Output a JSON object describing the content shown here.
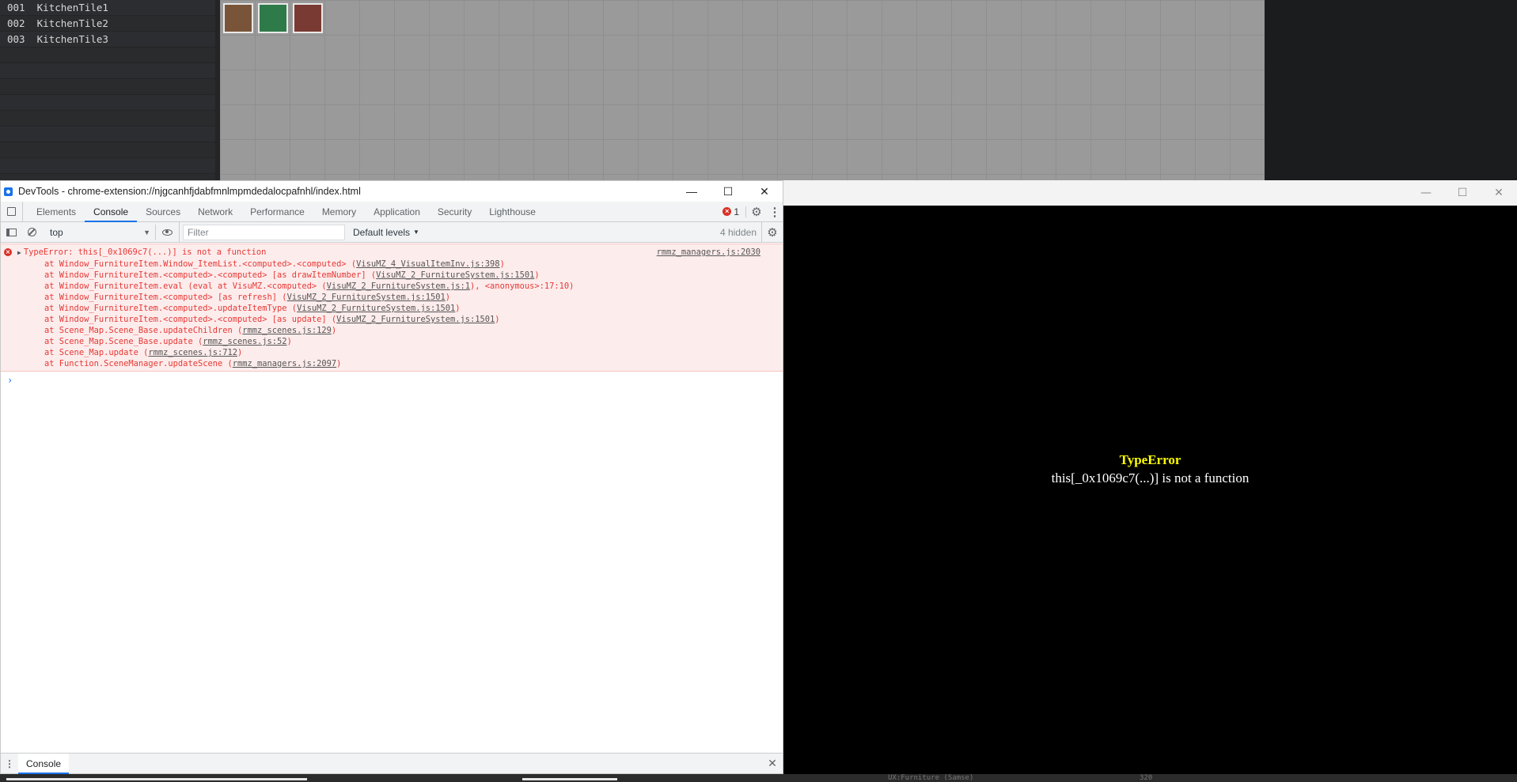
{
  "editor": {
    "list": [
      {
        "num": "001",
        "name": "KitchenTile1"
      },
      {
        "num": "002",
        "name": "KitchenTile2"
      },
      {
        "num": "003",
        "name": "KitchenTile3"
      }
    ],
    "tile_colors": [
      "#7a5439",
      "#2f7a49",
      "#7a3a34"
    ]
  },
  "devtools": {
    "title": "DevTools - chrome-extension://njgcanhfjdabfmnlmpmdedalocpafnhl/index.html",
    "tabs": [
      "Elements",
      "Console",
      "Sources",
      "Network",
      "Performance",
      "Memory",
      "Application",
      "Security",
      "Lighthouse"
    ],
    "active_tab": "Console",
    "error_count": "1",
    "toolbar": {
      "context": "top",
      "filter_placeholder": "Filter",
      "levels": "Default levels",
      "hidden": "4 hidden"
    },
    "error": {
      "message": "TypeError: this[_0x1069c7(...)] is not a function",
      "source": "rmmz_managers.js:2030",
      "stack": [
        {
          "text": "    at Window_FurnitureItem.Window_ItemList.<computed>.<computed> (",
          "link": "VisuMZ_4_VisualItemInv.js:398",
          "tail": ")"
        },
        {
          "text": "    at Window_FurnitureItem.<computed>.<computed> [as drawItemNumber] (",
          "link": "VisuMZ_2_FurnitureSystem.js:1501",
          "tail": ")"
        },
        {
          "text": "    at Window_FurnitureItem.eval (eval at VisuMZ.<computed> (",
          "link": "VisuMZ_2_FurnitureSystem.js:1",
          "tail": "), <anonymous>:17:10)"
        },
        {
          "text": "    at Window_FurnitureItem.<computed> [as refresh] (",
          "link": "VisuMZ_2_FurnitureSystem.js:1501",
          "tail": ")"
        },
        {
          "text": "    at Window_FurnitureItem.<computed>.updateItemType (",
          "link": "VisuMZ_2_FurnitureSystem.js:1501",
          "tail": ")"
        },
        {
          "text": "    at Window_FurnitureItem.<computed>.<computed> [as update] (",
          "link": "VisuMZ_2_FurnitureSystem.js:1501",
          "tail": ")"
        },
        {
          "text": "    at Scene_Map.Scene_Base.updateChildren (",
          "link": "rmmz_scenes.js:129",
          "tail": ")"
        },
        {
          "text": "    at Scene_Map.Scene_Base.update (",
          "link": "rmmz_scenes.js:52",
          "tail": ")"
        },
        {
          "text": "    at Scene_Map.update (",
          "link": "rmmz_scenes.js:712",
          "tail": ")"
        },
        {
          "text": "    at Function.SceneManager.updateScene (",
          "link": "rmmz_managers.js:2097",
          "tail": ")"
        }
      ]
    },
    "prompt": "›",
    "drawer_tab": "Console"
  },
  "game": {
    "error_title": "TypeError",
    "error_message": "this[_0x1069c7(...)] is not a function"
  },
  "bottom": {
    "left_text": "UX:Furniture (Samse)",
    "right_text": "320"
  }
}
